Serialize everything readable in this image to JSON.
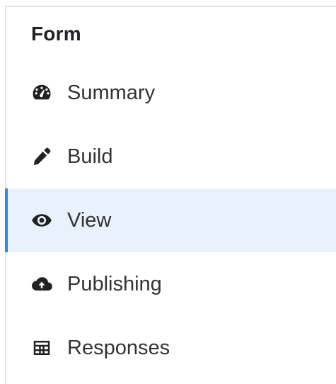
{
  "nav": {
    "title": "Form",
    "items": [
      {
        "label": "Summary",
        "icon": "dashboard-gauge-icon",
        "active": false
      },
      {
        "label": "Build",
        "icon": "pencil-icon",
        "active": false
      },
      {
        "label": "View",
        "icon": "eye-icon",
        "active": true
      },
      {
        "label": "Publishing",
        "icon": "cloud-upload-icon",
        "active": false
      },
      {
        "label": "Responses",
        "icon": "table-icon",
        "active": false
      }
    ]
  },
  "colors": {
    "active_background": "#e8f1fc",
    "active_border": "#3f84d8",
    "frame_border": "#e3e3e3",
    "text": "#333333",
    "title_text": "#202124"
  }
}
